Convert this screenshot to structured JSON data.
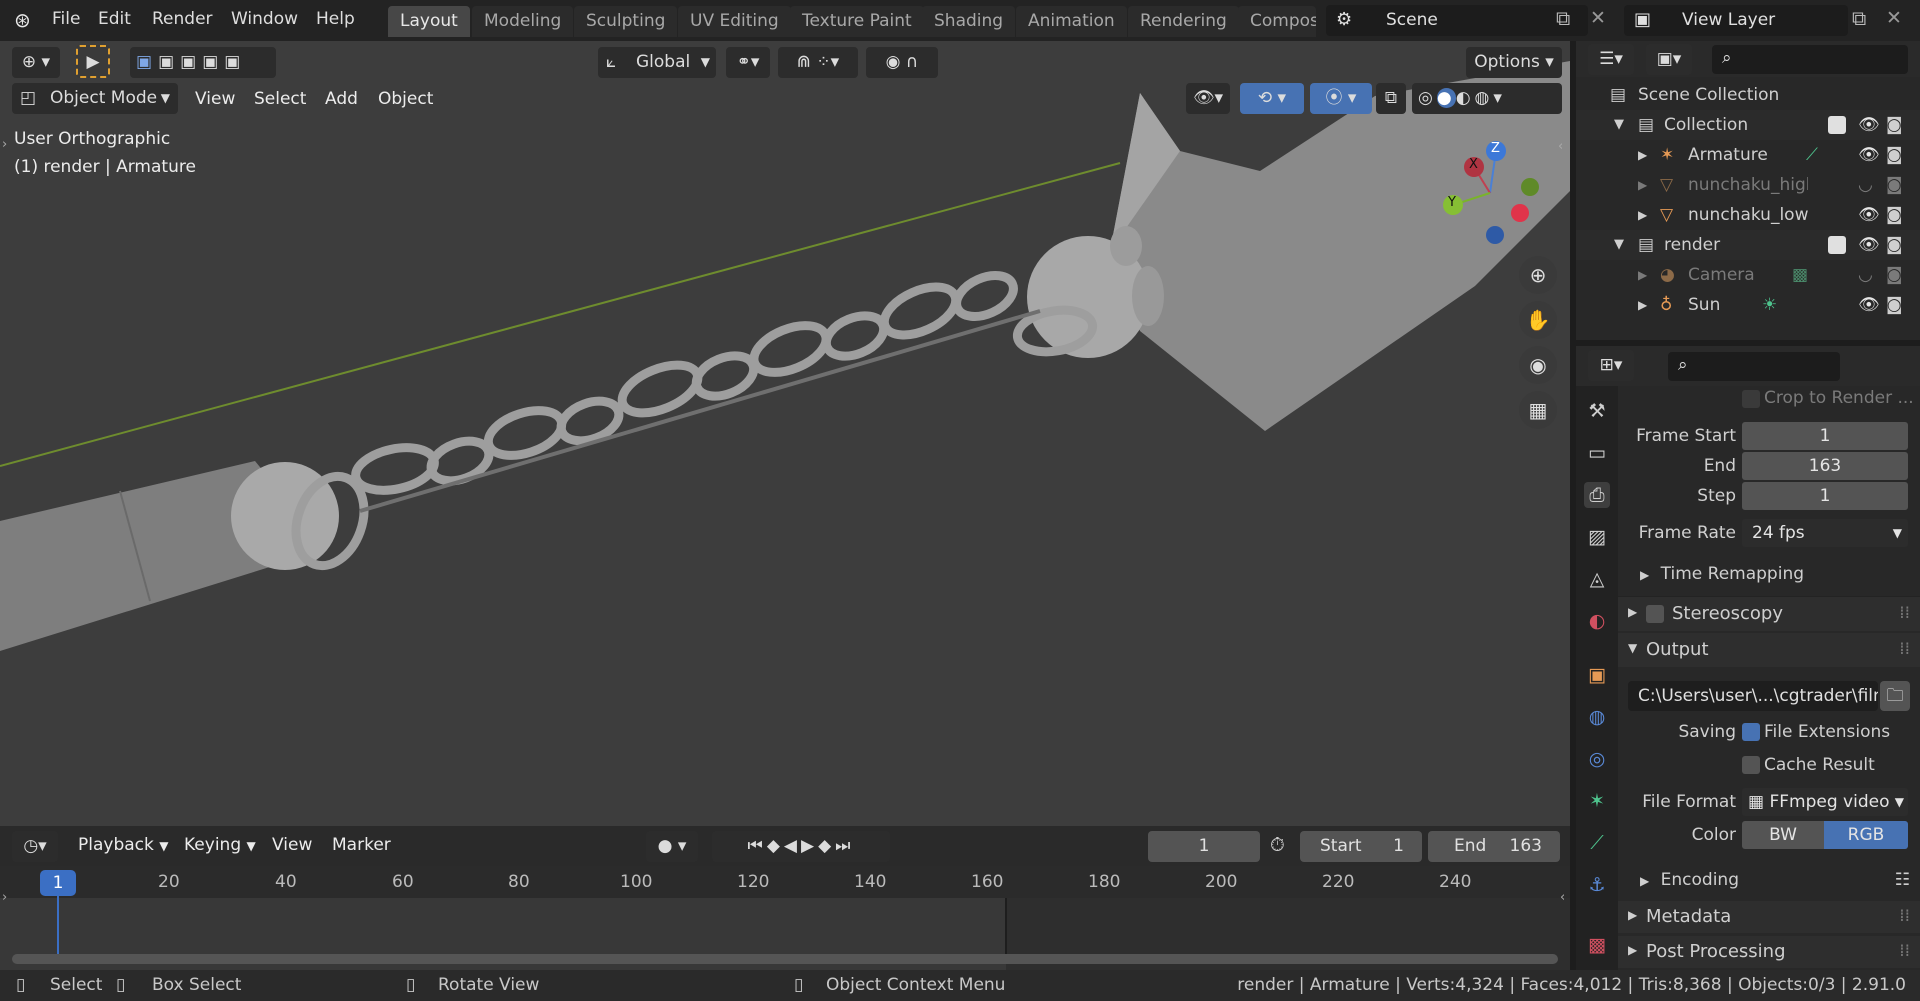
{
  "menu": [
    "File",
    "Edit",
    "Render",
    "Window",
    "Help"
  ],
  "workspaces": [
    "Layout",
    "Modeling",
    "Sculpting",
    "UV Editing",
    "Texture Paint",
    "Shading",
    "Animation",
    "Rendering",
    "Compos"
  ],
  "scene": {
    "label": "Scene"
  },
  "view_layer": {
    "label": "View Layer"
  },
  "viewport_header": {
    "transform_orientation": "Global",
    "options": "Options",
    "mode": "Object Mode",
    "menus": [
      "View",
      "Select",
      "Add",
      "Object"
    ]
  },
  "viewport": {
    "view_name": "User Orthographic",
    "context": "(1) render | Armature",
    "gizmo": {
      "x": "X",
      "y": "Y",
      "z": "Z"
    }
  },
  "outliner": {
    "root": "Scene Collection",
    "rows": [
      {
        "label": "Collection"
      },
      {
        "label": "Armature"
      },
      {
        "label": "nunchaku_high"
      },
      {
        "label": "nunchaku_low"
      },
      {
        "label": "render"
      },
      {
        "label": "Camera"
      },
      {
        "label": "Sun"
      }
    ]
  },
  "properties": {
    "crop": "Crop to Render ...",
    "frame_start_label": "Frame Start",
    "frame_start": "1",
    "end_label": "End",
    "end": "163",
    "step_label": "Step",
    "step": "1",
    "frame_rate_label": "Frame Rate",
    "frame_rate": "24 fps",
    "time_remapping": "Time Remapping",
    "stereoscopy": "Stereoscopy",
    "output": "Output",
    "output_path": "C:\\Users\\user\\...\\cgtrader\\film",
    "saving_label": "Saving",
    "file_extensions": "File Extensions",
    "cache_result": "Cache Result",
    "file_format_label": "File Format",
    "file_format": "FFmpeg video",
    "color_label": "Color",
    "color_bw": "BW",
    "color_rgb": "RGB",
    "encoding": "Encoding",
    "metadata": "Metadata",
    "post_processing": "Post Processing"
  },
  "timeline": {
    "menus": [
      "Playback",
      "Keying",
      "View",
      "Marker"
    ],
    "current_frame": "1",
    "start_label": "Start",
    "start": "1",
    "end_label": "End",
    "end": "163",
    "ticks": [
      "1",
      "20",
      "40",
      "60",
      "80",
      "100",
      "120",
      "140",
      "160",
      "180",
      "200",
      "220",
      "240"
    ]
  },
  "status": {
    "select": "Select",
    "box_select": "Box Select",
    "rotate_view": "Rotate View",
    "context_menu": "Object Context Menu",
    "info": "render | Armature | Verts:4,324 | Faces:4,012 | Tris:8,368 | Objects:0/3 | 2.91.0"
  },
  "colors": {
    "accent": "#4772b3",
    "active_frame": "#3b6fc4",
    "grid_line": "#6e8c2e"
  }
}
